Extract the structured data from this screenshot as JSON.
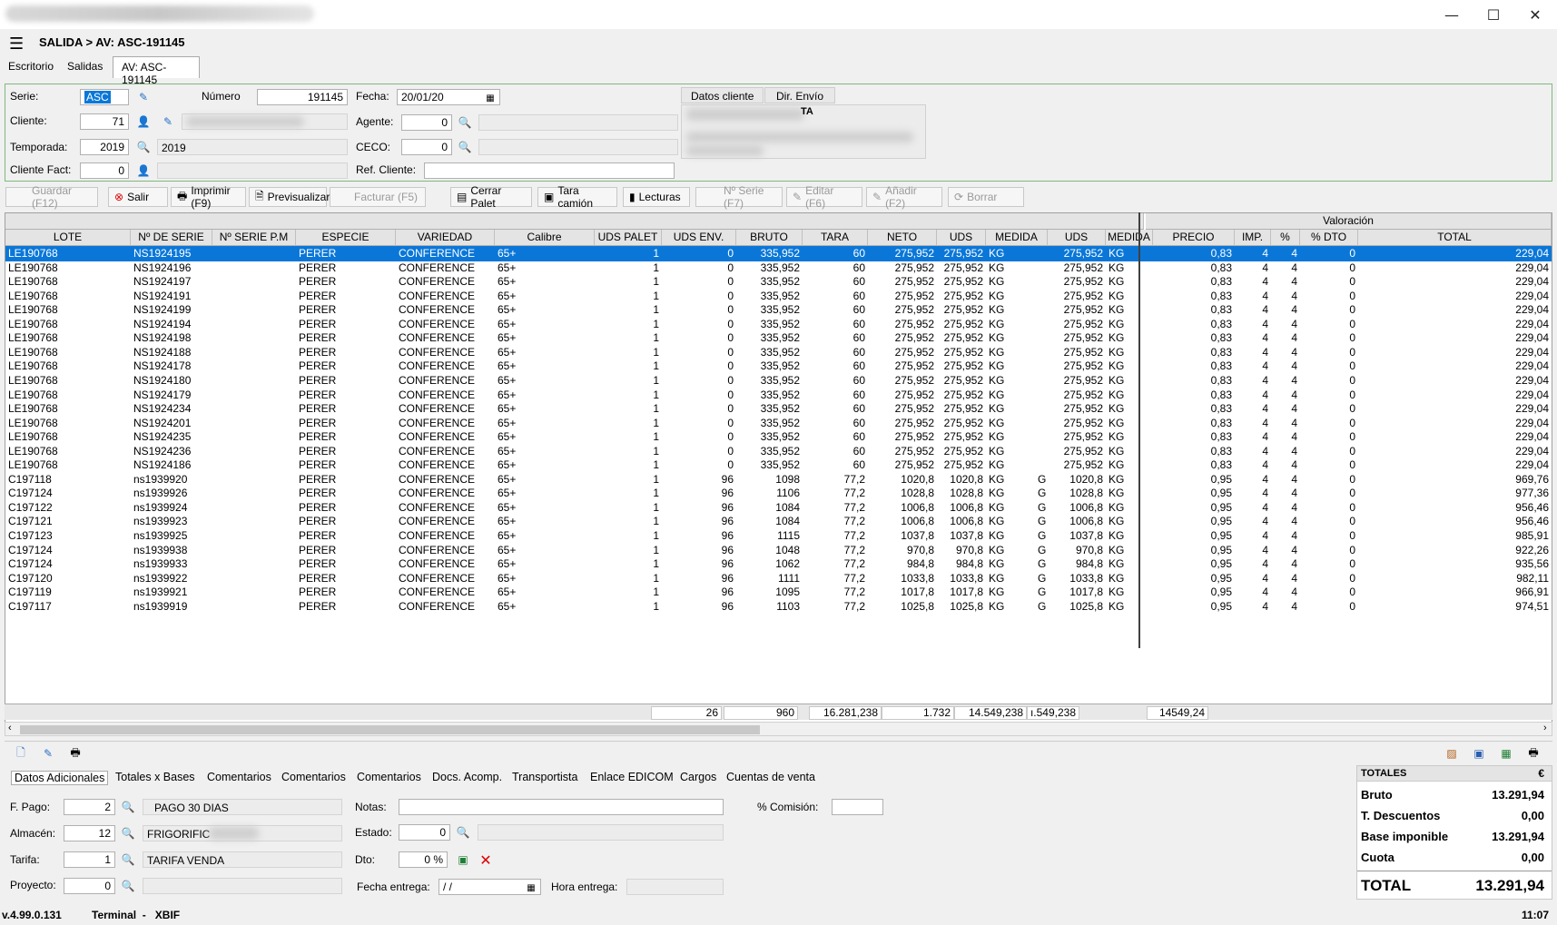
{
  "window": {
    "minimize": "—",
    "maximize": "☐",
    "close": "✕"
  },
  "header": {
    "title": "SALIDA > AV: ASC-191145"
  },
  "tabs": [
    "Escritorio",
    "Salidas",
    "AV: ASC-191145"
  ],
  "form": {
    "serie_label": "Serie:",
    "serie_value": "ASC",
    "numero_label": "Número",
    "numero_value": "191145",
    "fecha_label": "Fecha:",
    "fecha_value": "20/01/20",
    "cliente_label": "Cliente:",
    "cliente_value": "71",
    "agente_label": "Agente:",
    "agente_value": "0",
    "temporada_label": "Temporada:",
    "temporada_value": "2019",
    "temporada_desc": "2019",
    "ceco_label": "CECO:",
    "ceco_value": "0",
    "clientefact_label": "Cliente Fact:",
    "clientefact_value": "0",
    "refcliente_label": "Ref. Cliente:",
    "datos_cliente_tab": "Datos cliente",
    "dir_envio_tab": "Dir. Envío",
    "client_partial": "TA"
  },
  "toolbar": {
    "guardar": "Guardar (F12)",
    "salir": "Salir",
    "imprimir": "Imprimir (F9)",
    "previsualizar": "Previsualizar",
    "facturar": "Facturar (F5)",
    "cerrar_palet": "Cerrar Palet",
    "tara_camion": "Tara camión",
    "lecturas": "Lecturas",
    "nserie": "Nº Serie (F7)",
    "editar": "Editar (F6)",
    "anadir": "Añadir (F2)",
    "borrar": "Borrar"
  },
  "grid": {
    "group_header": "Valoración",
    "columns": [
      "LOTE",
      "Nº DE SERIE",
      "Nº SERIE P.M",
      "ESPECIE",
      "VARIEDAD",
      "Calibre",
      "UDS PALET",
      "UDS ENV.",
      "BRUTO",
      "TARA",
      "NETO",
      "UDS",
      "MEDIDA",
      "UDS",
      "MEDIDA",
      "PRECIO",
      "IMP.",
      "%",
      "% DTO",
      "TOTAL"
    ],
    "rows": [
      [
        "LE190768",
        "NS1924195",
        "",
        "PERER",
        "CONFERENCE",
        "65+",
        "1",
        "0",
        "335,952",
        "60",
        "275,952",
        "275,952",
        "KG",
        "",
        "275,952",
        "KG",
        "0,83",
        "4",
        "4",
        "0",
        "229,04"
      ],
      [
        "LE190768",
        "NS1924196",
        "",
        "PERER",
        "CONFERENCE",
        "65+",
        "1",
        "0",
        "335,952",
        "60",
        "275,952",
        "275,952",
        "KG",
        "",
        "275,952",
        "KG",
        "0,83",
        "4",
        "4",
        "0",
        "229,04"
      ],
      [
        "LE190768",
        "NS1924197",
        "",
        "PERER",
        "CONFERENCE",
        "65+",
        "1",
        "0",
        "335,952",
        "60",
        "275,952",
        "275,952",
        "KG",
        "",
        "275,952",
        "KG",
        "0,83",
        "4",
        "4",
        "0",
        "229,04"
      ],
      [
        "LE190768",
        "NS1924191",
        "",
        "PERER",
        "CONFERENCE",
        "65+",
        "1",
        "0",
        "335,952",
        "60",
        "275,952",
        "275,952",
        "KG",
        "",
        "275,952",
        "KG",
        "0,83",
        "4",
        "4",
        "0",
        "229,04"
      ],
      [
        "LE190768",
        "NS1924199",
        "",
        "PERER",
        "CONFERENCE",
        "65+",
        "1",
        "0",
        "335,952",
        "60",
        "275,952",
        "275,952",
        "KG",
        "",
        "275,952",
        "KG",
        "0,83",
        "4",
        "4",
        "0",
        "229,04"
      ],
      [
        "LE190768",
        "NS1924194",
        "",
        "PERER",
        "CONFERENCE",
        "65+",
        "1",
        "0",
        "335,952",
        "60",
        "275,952",
        "275,952",
        "KG",
        "",
        "275,952",
        "KG",
        "0,83",
        "4",
        "4",
        "0",
        "229,04"
      ],
      [
        "LE190768",
        "NS1924198",
        "",
        "PERER",
        "CONFERENCE",
        "65+",
        "1",
        "0",
        "335,952",
        "60",
        "275,952",
        "275,952",
        "KG",
        "",
        "275,952",
        "KG",
        "0,83",
        "4",
        "4",
        "0",
        "229,04"
      ],
      [
        "LE190768",
        "NS1924188",
        "",
        "PERER",
        "CONFERENCE",
        "65+",
        "1",
        "0",
        "335,952",
        "60",
        "275,952",
        "275,952",
        "KG",
        "",
        "275,952",
        "KG",
        "0,83",
        "4",
        "4",
        "0",
        "229,04"
      ],
      [
        "LE190768",
        "NS1924178",
        "",
        "PERER",
        "CONFERENCE",
        "65+",
        "1",
        "0",
        "335,952",
        "60",
        "275,952",
        "275,952",
        "KG",
        "",
        "275,952",
        "KG",
        "0,83",
        "4",
        "4",
        "0",
        "229,04"
      ],
      [
        "LE190768",
        "NS1924180",
        "",
        "PERER",
        "CONFERENCE",
        "65+",
        "1",
        "0",
        "335,952",
        "60",
        "275,952",
        "275,952",
        "KG",
        "",
        "275,952",
        "KG",
        "0,83",
        "4",
        "4",
        "0",
        "229,04"
      ],
      [
        "LE190768",
        "NS1924179",
        "",
        "PERER",
        "CONFERENCE",
        "65+",
        "1",
        "0",
        "335,952",
        "60",
        "275,952",
        "275,952",
        "KG",
        "",
        "275,952",
        "KG",
        "0,83",
        "4",
        "4",
        "0",
        "229,04"
      ],
      [
        "LE190768",
        "NS1924234",
        "",
        "PERER",
        "CONFERENCE",
        "65+",
        "1",
        "0",
        "335,952",
        "60",
        "275,952",
        "275,952",
        "KG",
        "",
        "275,952",
        "KG",
        "0,83",
        "4",
        "4",
        "0",
        "229,04"
      ],
      [
        "LE190768",
        "NS1924201",
        "",
        "PERER",
        "CONFERENCE",
        "65+",
        "1",
        "0",
        "335,952",
        "60",
        "275,952",
        "275,952",
        "KG",
        "",
        "275,952",
        "KG",
        "0,83",
        "4",
        "4",
        "0",
        "229,04"
      ],
      [
        "LE190768",
        "NS1924235",
        "",
        "PERER",
        "CONFERENCE",
        "65+",
        "1",
        "0",
        "335,952",
        "60",
        "275,952",
        "275,952",
        "KG",
        "",
        "275,952",
        "KG",
        "0,83",
        "4",
        "4",
        "0",
        "229,04"
      ],
      [
        "LE190768",
        "NS1924236",
        "",
        "PERER",
        "CONFERENCE",
        "65+",
        "1",
        "0",
        "335,952",
        "60",
        "275,952",
        "275,952",
        "KG",
        "",
        "275,952",
        "KG",
        "0,83",
        "4",
        "4",
        "0",
        "229,04"
      ],
      [
        "LE190768",
        "NS1924186",
        "",
        "PERER",
        "CONFERENCE",
        "65+",
        "1",
        "0",
        "335,952",
        "60",
        "275,952",
        "275,952",
        "KG",
        "",
        "275,952",
        "KG",
        "0,83",
        "4",
        "4",
        "0",
        "229,04"
      ],
      [
        "C197118",
        "ns1939920",
        "",
        "PERER",
        "CONFERENCE",
        "65+",
        "1",
        "96",
        "1098",
        "77,2",
        "1020,8",
        "1020,8",
        "KG",
        "G",
        "1020,8",
        "KG",
        "0,95",
        "4",
        "4",
        "0",
        "969,76"
      ],
      [
        "C197124",
        "ns1939926",
        "",
        "PERER",
        "CONFERENCE",
        "65+",
        "1",
        "96",
        "1106",
        "77,2",
        "1028,8",
        "1028,8",
        "KG",
        "G",
        "1028,8",
        "KG",
        "0,95",
        "4",
        "4",
        "0",
        "977,36"
      ],
      [
        "C197122",
        "ns1939924",
        "",
        "PERER",
        "CONFERENCE",
        "65+",
        "1",
        "96",
        "1084",
        "77,2",
        "1006,8",
        "1006,8",
        "KG",
        "G",
        "1006,8",
        "KG",
        "0,95",
        "4",
        "4",
        "0",
        "956,46"
      ],
      [
        "C197121",
        "ns1939923",
        "",
        "PERER",
        "CONFERENCE",
        "65+",
        "1",
        "96",
        "1084",
        "77,2",
        "1006,8",
        "1006,8",
        "KG",
        "G",
        "1006,8",
        "KG",
        "0,95",
        "4",
        "4",
        "0",
        "956,46"
      ],
      [
        "C197123",
        "ns1939925",
        "",
        "PERER",
        "CONFERENCE",
        "65+",
        "1",
        "96",
        "1115",
        "77,2",
        "1037,8",
        "1037,8",
        "KG",
        "G",
        "1037,8",
        "KG",
        "0,95",
        "4",
        "4",
        "0",
        "985,91"
      ],
      [
        "C197124",
        "ns1939938",
        "",
        "PERER",
        "CONFERENCE",
        "65+",
        "1",
        "96",
        "1048",
        "77,2",
        "970,8",
        "970,8",
        "KG",
        "G",
        "970,8",
        "KG",
        "0,95",
        "4",
        "4",
        "0",
        "922,26"
      ],
      [
        "C197124",
        "ns1939933",
        "",
        "PERER",
        "CONFERENCE",
        "65+",
        "1",
        "96",
        "1062",
        "77,2",
        "984,8",
        "984,8",
        "KG",
        "G",
        "984,8",
        "KG",
        "0,95",
        "4",
        "4",
        "0",
        "935,56"
      ],
      [
        "C197120",
        "ns1939922",
        "",
        "PERER",
        "CONFERENCE",
        "65+",
        "1",
        "96",
        "1111",
        "77,2",
        "1033,8",
        "1033,8",
        "KG",
        "G",
        "1033,8",
        "KG",
        "0,95",
        "4",
        "4",
        "0",
        "982,11"
      ],
      [
        "C197119",
        "ns1939921",
        "",
        "PERER",
        "CONFERENCE",
        "65+",
        "1",
        "96",
        "1095",
        "77,2",
        "1017,8",
        "1017,8",
        "KG",
        "G",
        "1017,8",
        "KG",
        "0,95",
        "4",
        "4",
        "0",
        "966,91"
      ],
      [
        "C197117",
        "ns1939919",
        "",
        "PERER",
        "CONFERENCE",
        "65+",
        "1",
        "96",
        "1103",
        "77,2",
        "1025,8",
        "1025,8",
        "KG",
        "G",
        "1025,8",
        "KG",
        "0,95",
        "4",
        "4",
        "0",
        "974,51"
      ]
    ],
    "totals": {
      "uds_palet": "26",
      "uds_env": "960",
      "bruto": "16.281,238",
      "tara": "1.732",
      "neto": "14.549,238",
      "uds": "ı.549,238",
      "uds_val": "14549,24"
    }
  },
  "bottom_tabs": [
    "Datos Adicionales",
    "Totales x Bases",
    "Comentarios",
    "Comentarios",
    "Comentarios",
    "Docs. Acomp.",
    "Transportista",
    "Enlace EDICOM",
    "Cargos",
    "Cuentas de venta"
  ],
  "extra": {
    "fpago_label": "F. Pago:",
    "fpago_value": "2",
    "fpago_desc": "PAGO 30 DIAS",
    "almacen_label": "Almacén:",
    "almacen_value": "12",
    "almacen_desc": "FRIGORIFIC",
    "tarifa_label": "Tarifa:",
    "tarifa_value": "1",
    "tarifa_desc": "TARIFA VENDA",
    "proyecto_label": "Proyecto:",
    "proyecto_value": "0",
    "notas_label": "Notas:",
    "estado_label": "Estado:",
    "estado_value": "0",
    "dto_label": "Dto:",
    "dto_value": "0 %",
    "fecha_entrega_label": "Fecha entrega:",
    "fecha_entrega_value": " / /",
    "hora_entrega_label": "Hora entrega:",
    "comision_label": "% Comisión:"
  },
  "totals_panel": {
    "header": "TOTALES",
    "currency": "€",
    "bruto_label": "Bruto",
    "bruto": "13.291,94",
    "descuentos_label": "T. Descuentos",
    "descuentos": "0,00",
    "base_label": "Base imponible",
    "base": "13.291,94",
    "cuota_label": "Cuota",
    "cuota": "0,00",
    "total_label": "TOTAL",
    "total": "13.291,94"
  },
  "status": {
    "version": "v.4.99.0.131",
    "terminal": "Terminal  -   XBIF",
    "time": "11:07"
  }
}
